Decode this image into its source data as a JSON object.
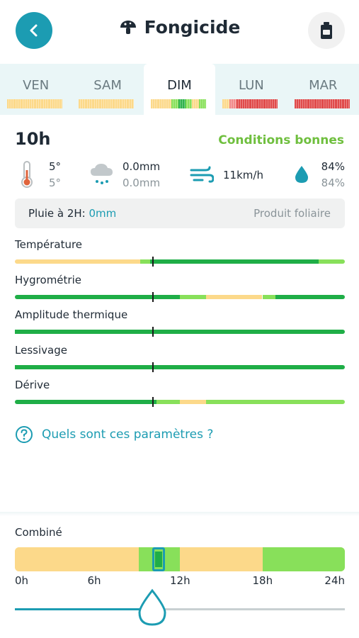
{
  "header": {
    "title": "Fongicide",
    "back_icon": "chevron-left-icon",
    "title_icon": "mushroom-icon",
    "action_icon": "product-can-icon"
  },
  "tabs": [
    {
      "label": "VEN",
      "colors": [
        "#fcd98a",
        "#fcd98a",
        "#fcd98a",
        "#fcd98a",
        "#fcd98a",
        "#fcd98a",
        "#fcd98a",
        "#fcd98a"
      ],
      "active": false
    },
    {
      "label": "SAM",
      "colors": [
        "#fcd98a",
        "#fcd98a",
        "#fcd98a",
        "#fcd98a",
        "#fcd98a",
        "#fcd98a",
        "#fcd98a",
        "#fcd98a"
      ],
      "active": false
    },
    {
      "label": "DIM",
      "colors": [
        "#fcd98a",
        "#fcd98a",
        "#fcd98a",
        "#88e05a",
        "#2fb24c",
        "#88e05a",
        "#fcd98a",
        "#88e05a"
      ],
      "active": true
    },
    {
      "label": "LUN",
      "colors": [
        "#fcd98a",
        "#f28a8a",
        "#e04b4b",
        "#e04b4b",
        "#e04b4b",
        "#e04b4b",
        "#e04b4b",
        "#e04b4b"
      ],
      "active": false
    },
    {
      "label": "MAR",
      "colors": [
        "#e04b4b",
        "#e04b4b",
        "#e04b4b",
        "#e04b4b",
        "#e04b4b",
        "#e04b4b",
        "#e04b4b",
        "#e04b4b"
      ],
      "active": false
    }
  ],
  "hour": "10h",
  "conditions": "Conditions bonnes",
  "weather": {
    "temp": "5°",
    "temp_sub": "5°",
    "rain": "0.0mm",
    "rain_sub": "0.0mm",
    "wind": "11km/h",
    "humidity": "84%",
    "humidity_sub": "84%"
  },
  "info": {
    "rain_label": "Pluie à 2H: ",
    "rain_value": "0mm",
    "product": "Produit foliaire"
  },
  "parameters": [
    {
      "label": "Température",
      "segments": [
        {
          "from": 0,
          "to": 0.38,
          "color": "#fcd98a"
        },
        {
          "from": 0.38,
          "to": 0.41,
          "color": "#88e05a"
        },
        {
          "from": 0.41,
          "to": 0.92,
          "color": "#1fae47"
        },
        {
          "from": 0.92,
          "to": 1,
          "color": "#88e05a"
        }
      ]
    },
    {
      "label": "Hygrométrie",
      "segments": [
        {
          "from": 0,
          "to": 0.5,
          "color": "#1fae47"
        },
        {
          "from": 0.5,
          "to": 0.58,
          "color": "#88e05a"
        },
        {
          "from": 0.58,
          "to": 0.75,
          "color": "#fcd98a"
        },
        {
          "from": 0.75,
          "to": 0.79,
          "color": "#88e05a"
        },
        {
          "from": 0.79,
          "to": 1,
          "color": "#1fae47"
        }
      ]
    },
    {
      "label": "Amplitude thermique",
      "segments": [
        {
          "from": 0,
          "to": 1,
          "color": "#1fae47"
        }
      ]
    },
    {
      "label": "Lessivage",
      "segments": [
        {
          "from": 0,
          "to": 1,
          "color": "#1fae47"
        }
      ]
    },
    {
      "label": "Dérive",
      "segments": [
        {
          "from": 0,
          "to": 0.43,
          "color": "#1fae47"
        },
        {
          "from": 0.43,
          "to": 0.5,
          "color": "#88e05a"
        },
        {
          "from": 0.5,
          "to": 0.58,
          "color": "#fcd98a"
        },
        {
          "from": 0.58,
          "to": 1,
          "color": "#88e05a"
        }
      ]
    }
  ],
  "help": {
    "text": "Quels sont ces paramètres ?",
    "icon": "question-circle-icon"
  },
  "combined": {
    "label": "Combiné",
    "segments": [
      {
        "from": 0,
        "to": 0.375,
        "color": "#fcd98a"
      },
      {
        "from": 0.375,
        "to": 0.5,
        "color": "#88e05a"
      },
      {
        "from": 0.5,
        "to": 0.75,
        "color": "#fcd98a"
      },
      {
        "from": 0.75,
        "to": 1,
        "color": "#88e05a"
      }
    ],
    "selected_hour": 10,
    "ticks": [
      "0h",
      "6h",
      "12h",
      "18h",
      "24h"
    ]
  },
  "slider": {
    "value_fraction": 0.41667,
    "thumb_icon": "drop-thumb-icon"
  }
}
